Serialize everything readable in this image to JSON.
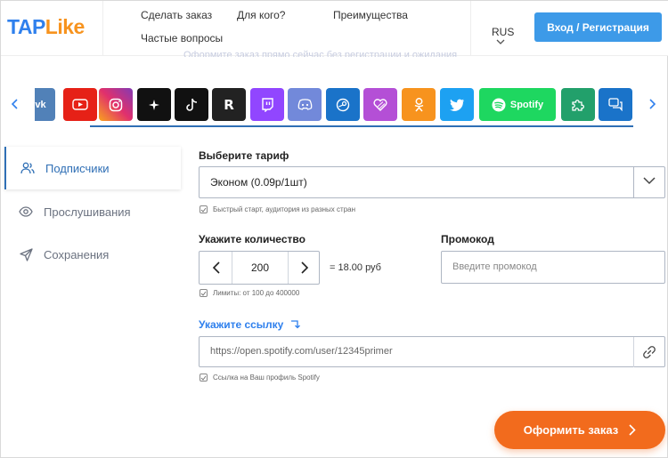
{
  "brand": {
    "part1": "TAP",
    "part2": "Like"
  },
  "nav": {
    "order": "Сделать заказ",
    "for_whom": "Для кого?",
    "advantages": "Преимущества",
    "faq": "Частые вопросы"
  },
  "language": "RUS",
  "login_button": "Вход / Регистрация",
  "faint_banner": "Оформите заказ прямо сейчас без регистрации и ожидания",
  "socials": [
    {
      "name": "vk",
      "color": "#5181b8"
    },
    {
      "name": "youtube",
      "color": "#e62117"
    },
    {
      "name": "instagram",
      "color": "#c13584"
    },
    {
      "name": "threads",
      "color": "#111111"
    },
    {
      "name": "tiktok",
      "color": "#111111"
    },
    {
      "name": "rutube",
      "color": "#222222"
    },
    {
      "name": "twitch",
      "color": "#9146ff"
    },
    {
      "name": "discord",
      "color": "#7289da"
    },
    {
      "name": "steam",
      "color": "#1a73c9"
    },
    {
      "name": "likee",
      "color": "#b44fd6"
    },
    {
      "name": "odnoklassniki",
      "color": "#f7931e"
    },
    {
      "name": "twitter",
      "color": "#1da1f2"
    },
    {
      "name": "spotify",
      "color": "#1ed760",
      "label": "Spotify"
    },
    {
      "name": "puzzle",
      "color": "#22a06b"
    },
    {
      "name": "messages",
      "color": "#1a73c9"
    }
  ],
  "menu": [
    {
      "label": "Подписчики",
      "active": true
    },
    {
      "label": "Прослушивания",
      "active": false
    },
    {
      "label": "Сохранения",
      "active": false
    }
  ],
  "tariff": {
    "label": "Выберите тариф",
    "value": "Эконом (0.09р/1шт)",
    "hint": "Быстрый старт, аудитория из разных стран"
  },
  "quantity": {
    "label": "Укажите количество",
    "value": "200",
    "price": "= 18.00 руб",
    "hint": "Лимиты: от 100 до 400000"
  },
  "promo": {
    "label": "Промокод",
    "placeholder": "Введите промокод"
  },
  "link": {
    "label": "Укажите ссылку",
    "value": "https://open.spotify.com/user/12345primer",
    "hint": "Ссылка на Ваш профиль Spotify"
  },
  "order_button": "Оформить заказ",
  "colors": {
    "accent_blue": "#2f80ed",
    "brand_orange": "#f7931e",
    "order_orange": "#f26b1d"
  }
}
